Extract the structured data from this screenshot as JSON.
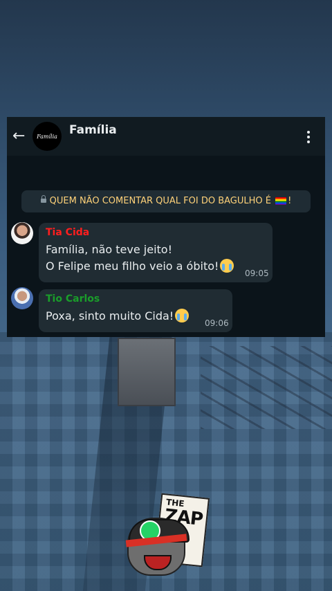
{
  "chat": {
    "group_name": "Família",
    "group_avatar_text": "Família",
    "notice": "QUEM NÃO COMENTAR QUAL FOI DO BAGULHO É",
    "notice_end": "!",
    "messages": [
      {
        "sender": "Tia Cida",
        "line1": "Família, não teve jeito!",
        "line2": "O Felipe meu filho veio a óbito!",
        "time": "09:05"
      },
      {
        "sender": "Tio Carlos",
        "line1": "Poxa, sinto muito Cida!",
        "time": "09:06"
      }
    ]
  },
  "sticker": {
    "title_small": "THE",
    "title_big": "ZAP"
  },
  "colors": {
    "chat_bg": "#0b141a",
    "bubble": "#202c33",
    "notice_text": "#ffd279",
    "sender_1": "#ff1e1e",
    "sender_2": "#1a9e2a"
  },
  "icons": [
    "back-arrow-icon",
    "more-vert-icon",
    "lock-icon",
    "rainbow-flag-icon",
    "crying-face-icon",
    "whatsapp-icon"
  ]
}
